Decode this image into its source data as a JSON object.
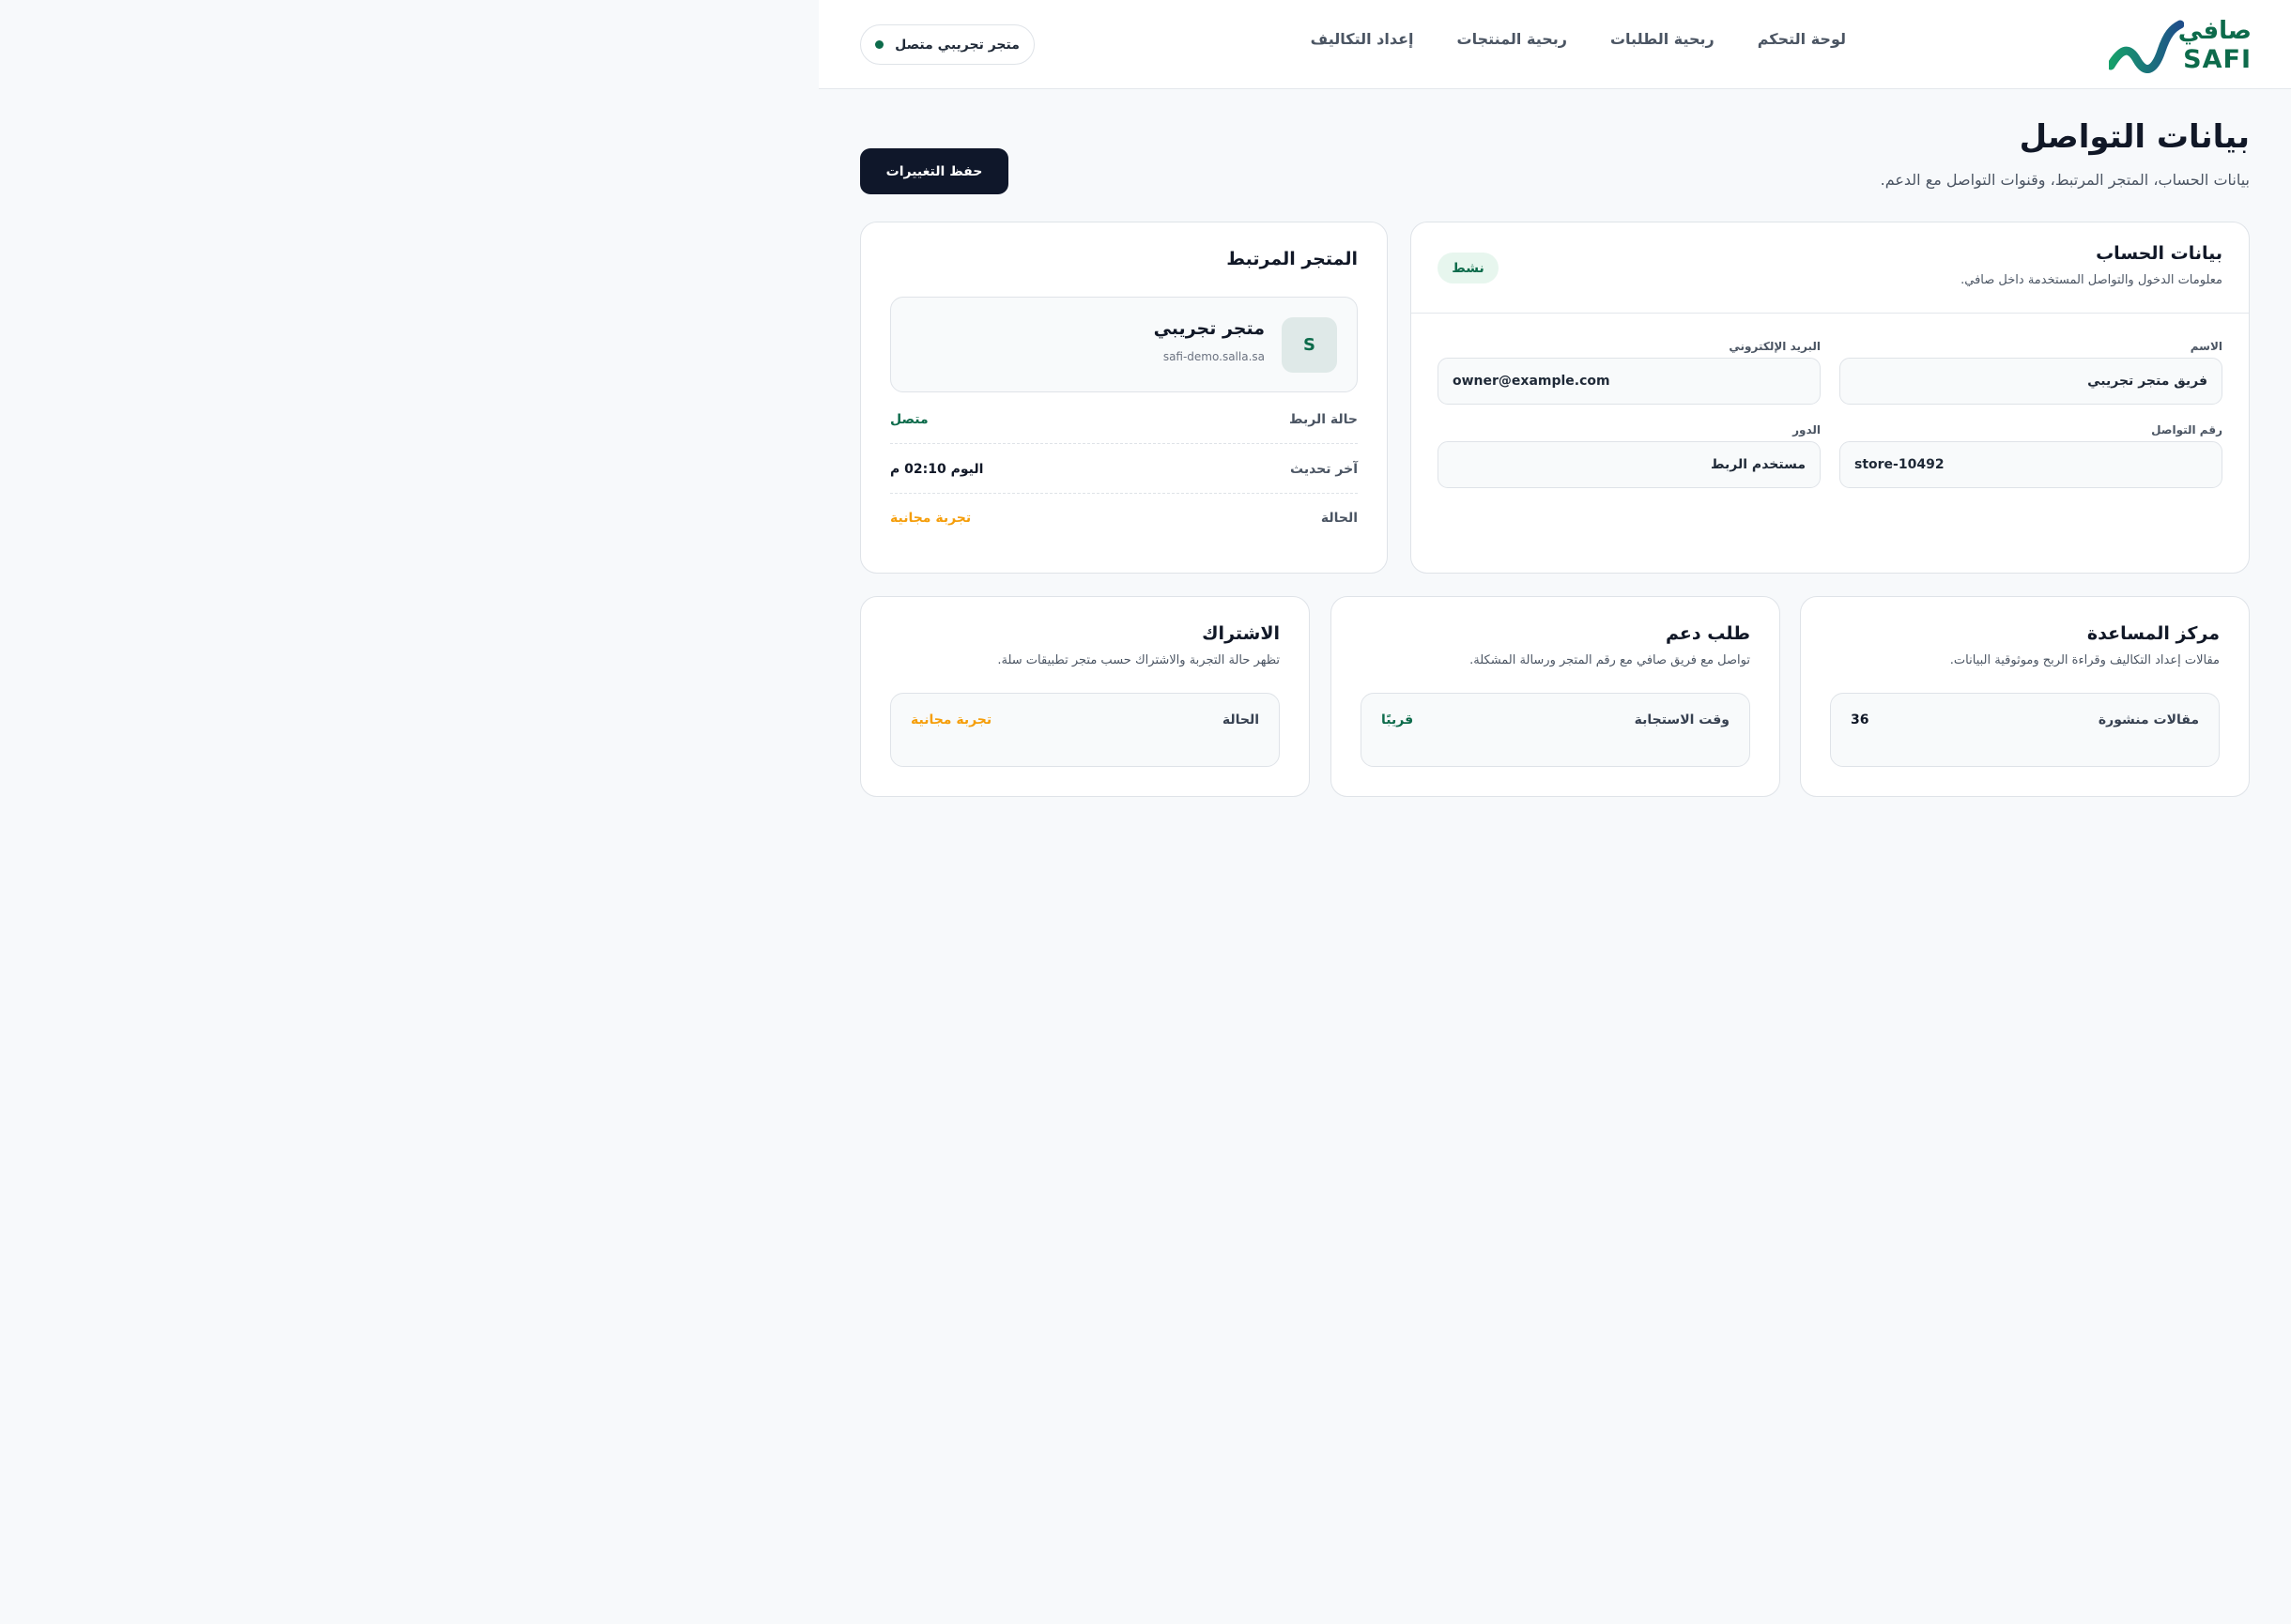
{
  "brand": {
    "name_ar": "صافي",
    "name_en": "SAFI"
  },
  "nav": {
    "items": [
      {
        "label": "لوحة التحكم"
      },
      {
        "label": "ربحية الطلبات"
      },
      {
        "label": "ربحية المنتجات"
      },
      {
        "label": "إعداد التكاليف"
      }
    ]
  },
  "store_status": {
    "label": "متجر تجريبي متصل"
  },
  "page": {
    "title": "بيانات التواصل",
    "subtitle": "بيانات الحساب، المتجر المرتبط، وقنوات التواصل مع الدعم.",
    "save_label": "حفظ التغييرات"
  },
  "account": {
    "title": "بيانات الحساب",
    "description": "معلومات الدخول والتواصل المستخدمة داخل صافي.",
    "status_badge": "نشط",
    "fields": {
      "name": {
        "label": "الاسم",
        "value": "فريق متجر تجريبي"
      },
      "email": {
        "label": "البريد الإلكتروني",
        "value": "owner@example.com"
      },
      "phone": {
        "label": "رقم التواصل",
        "value": "store-10492"
      },
      "role": {
        "label": "الدور",
        "value": "مستخدم الربط"
      }
    }
  },
  "linked_store": {
    "title": "المتجر المرتبط",
    "avatar_letter": "S",
    "name": "متجر تجريبي",
    "domain": "safi-demo.salla.sa",
    "rows": [
      {
        "label": "حالة الربط",
        "value": "متصل",
        "color": "#0d6b4b"
      },
      {
        "label": "آخر تحديث",
        "value": "اليوم 02:10 م",
        "color": "#111827"
      },
      {
        "label": "الحالة",
        "value": "تجربة مجانية",
        "color": "#f59e0b"
      }
    ]
  },
  "help_center": {
    "title": "مركز المساعدة",
    "description": "مقالات إعداد التكاليف وقراءة الربح وموثوقية البيانات.",
    "label": "مقالات منشورة",
    "value": "36",
    "color": "#111827"
  },
  "support": {
    "title": "طلب دعم",
    "description": "تواصل مع فريق صافي مع رقم المتجر ورسالة المشكلة.",
    "label": "وقت الاستجابة",
    "value": "قريبًا",
    "color": "#0d6b4b"
  },
  "subscription": {
    "title": "الاشتراك",
    "description": "تظهر حالة التجربة والاشتراك حسب متجر تطبيقات سلة.",
    "label": "الحالة",
    "value": "تجربة مجانية",
    "color": "#f59e0b"
  }
}
